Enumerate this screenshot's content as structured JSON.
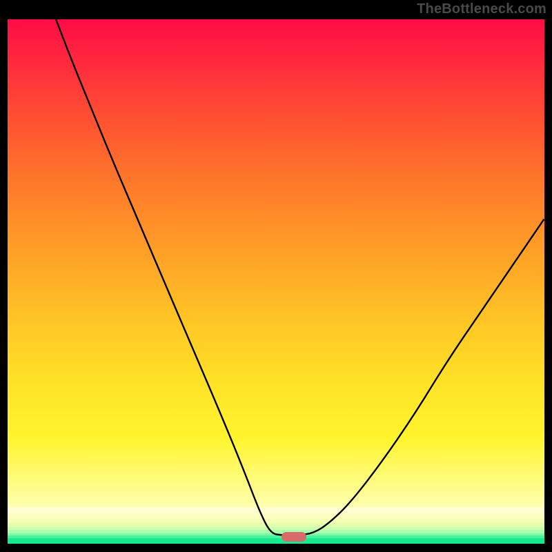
{
  "watermark": "TheBottleneck.com",
  "colors": {
    "frame": "#000000",
    "marker": "#d86a6a",
    "curve": "#000000",
    "green_band": "#17e991"
  },
  "bands": [
    {
      "color": "#ffffd2",
      "top_pct": 0,
      "h_pct": 18
    },
    {
      "color": "#fdffc0",
      "top_pct": 18,
      "h_pct": 14
    },
    {
      "color": "#f2ffb5",
      "top_pct": 32,
      "h_pct": 12
    },
    {
      "color": "#e2ffae",
      "top_pct": 44,
      "h_pct": 10
    },
    {
      "color": "#caffae",
      "top_pct": 54,
      "h_pct": 9
    },
    {
      "color": "#a8feab",
      "top_pct": 63,
      "h_pct": 8
    },
    {
      "color": "#7ef8a5",
      "top_pct": 71,
      "h_pct": 7
    },
    {
      "color": "#4df09b",
      "top_pct": 78,
      "h_pct": 7
    },
    {
      "color": "#17e991",
      "top_pct": 85,
      "h_pct": 15
    }
  ],
  "marker_rect": {
    "x_pct": 51.0,
    "y_pct": 97.8,
    "w_pct": 4.7
  },
  "chart_data": {
    "type": "line",
    "title": "",
    "xlabel": "",
    "ylabel": "",
    "xlim": [
      0,
      100
    ],
    "ylim": [
      0,
      100
    ],
    "series": [
      {
        "name": "bottleneck-curve",
        "notes": "Values read off the plot: y=0 is ideal (green band), y=100 is worst (top). x is horizontal position as percent of plot width. The visible curve starts near x≈9 at y=100, descends to a flat minimum around x≈49–57 at y≈1.6, then rises toward y≈62 at x=100.",
        "points": [
          {
            "x": 9,
            "y": 100
          },
          {
            "x": 12,
            "y": 92
          },
          {
            "x": 16,
            "y": 82
          },
          {
            "x": 20,
            "y": 72
          },
          {
            "x": 25,
            "y": 60
          },
          {
            "x": 30,
            "y": 48
          },
          {
            "x": 35,
            "y": 36
          },
          {
            "x": 40,
            "y": 24
          },
          {
            "x": 44,
            "y": 14
          },
          {
            "x": 47,
            "y": 6
          },
          {
            "x": 49,
            "y": 2
          },
          {
            "x": 51,
            "y": 1.6
          },
          {
            "x": 54,
            "y": 1.6
          },
          {
            "x": 57,
            "y": 2
          },
          {
            "x": 60,
            "y": 4
          },
          {
            "x": 64,
            "y": 8
          },
          {
            "x": 70,
            "y": 16
          },
          {
            "x": 76,
            "y": 25
          },
          {
            "x": 82,
            "y": 35
          },
          {
            "x": 88,
            "y": 44
          },
          {
            "x": 94,
            "y": 53
          },
          {
            "x": 100,
            "y": 62
          }
        ]
      }
    ],
    "highlight": {
      "x_start": 51,
      "x_end": 56,
      "y": 1.6
    }
  }
}
